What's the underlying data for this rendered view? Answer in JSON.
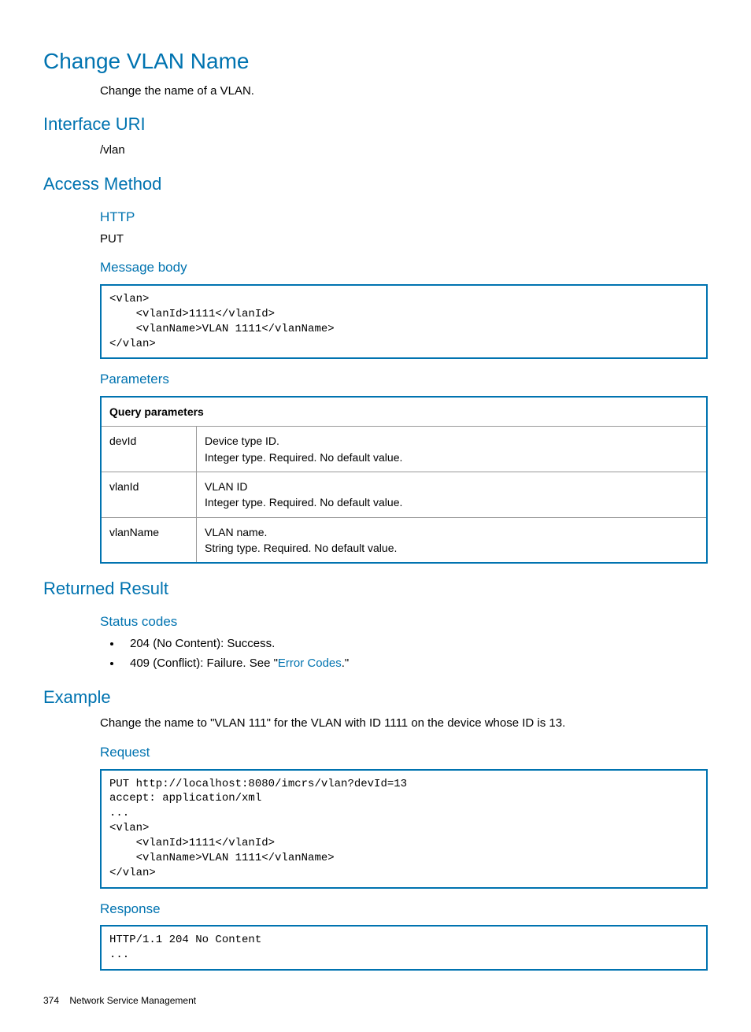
{
  "page_title": "Change VLAN Name",
  "page_desc": "Change the name of a VLAN.",
  "sections": {
    "interface_uri": {
      "heading": "Interface URI",
      "value": "/vlan"
    },
    "access_method": {
      "heading": "Access Method"
    },
    "http": {
      "heading": "HTTP",
      "value": "PUT"
    },
    "message_body": {
      "heading": "Message body",
      "code": "<vlan>\n    <vlanId>1111</vlanId>\n    <vlanName>VLAN 1111</vlanName>\n</vlan>"
    },
    "parameters": {
      "heading": "Parameters",
      "table_header": "Query parameters",
      "rows": [
        {
          "name": "devId",
          "desc1": "Device type ID.",
          "desc2": "Integer type. Required. No default value."
        },
        {
          "name": "vlanId",
          "desc1": "VLAN ID",
          "desc2": "Integer type. Required. No default value."
        },
        {
          "name": "vlanName",
          "desc1": "VLAN name.",
          "desc2": "String type. Required. No default value."
        }
      ]
    },
    "returned_result": {
      "heading": "Returned Result"
    },
    "status_codes": {
      "heading": "Status codes",
      "items": [
        {
          "text": "204 (No Content): Success."
        },
        {
          "prefix": "409 (Conflict): Failure. See \"",
          "link": "Error Codes",
          "suffix": ".\""
        }
      ]
    },
    "example": {
      "heading": "Example",
      "desc": "Change the name to \"VLAN 111\" for the VLAN with ID 1111 on the device whose ID is 13."
    },
    "request": {
      "heading": "Request",
      "code": "PUT http://localhost:8080/imcrs/vlan?devId=13\naccept: application/xml\n...\n<vlan>\n    <vlanId>1111</vlanId>\n    <vlanName>VLAN 1111</vlanName>\n</vlan>"
    },
    "response": {
      "heading": "Response",
      "code": "HTTP/1.1 204 No Content\n..."
    }
  },
  "footer": {
    "page_number": "374",
    "section": "Network Service Management"
  }
}
